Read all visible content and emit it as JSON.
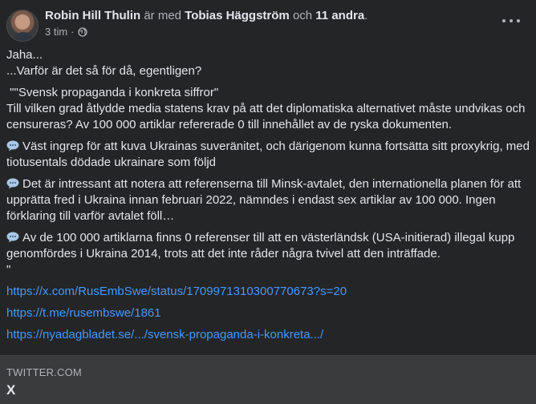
{
  "post": {
    "author": "Robin Hill Thulin",
    "with_text": "är med",
    "tagged": "Tobias Häggström",
    "and_text": "och",
    "others": "11 andra",
    "period": ".",
    "time": "3 tim",
    "separator": "·",
    "privacy_icon": "globe-icon",
    "more_icon": "more-options-icon"
  },
  "content": {
    "line1": "Jaha...",
    "line2": "...Varför är det så för då, egentligen?",
    "quote_title": " \"\"Svensk propaganda i konkreta siffror\"",
    "paragraph1": "Till vilken grad åtlydde media statens krav på att det diplomatiska alternativet måste undvikas och censureras? Av 100 000 artiklar refererade 0 till innehållet av de ryska dokumenten.",
    "bullet_icon": "speech-bubble-icon",
    "bullet1": "Väst ingrep för att kuva Ukrainas suveränitet, och därigenom kunna fortsätta sitt proxykrig, med tiotusentals dödade ukrainare som följd",
    "bullet2": "Det är intressant att notera att referenserna till Minsk-avtalet, den internationella planen för att upprätta fred i Ukraina innan februari 2022, nämndes i endast sex artiklar av 100 000. Ingen förklaring till varför avtalet föll…",
    "bullet3": "Av de 100 000 artiklarna finns 0 referenser till att en västerländsk (USA-initierad) illegal kupp genomfördes i Ukraina 2014, trots att det inte råder några tvivel att den inträffade.",
    "closing_quote": "\"",
    "links": [
      "https://x.com/RusEmbSwe/status/1709971310300770673?s=20",
      "https://t.me/rusembswe/1861",
      "https://nyadagbladet.se/.../svensk-propaganda-i-konkreta.../"
    ]
  },
  "preview": {
    "domain": "TWITTER.COM",
    "title": "X"
  },
  "colors": {
    "background": "#242526",
    "preview_background": "#3a3b3c",
    "link": "#4599ff",
    "text": "#e4e6eb",
    "secondary_text": "#b0b3b8"
  }
}
